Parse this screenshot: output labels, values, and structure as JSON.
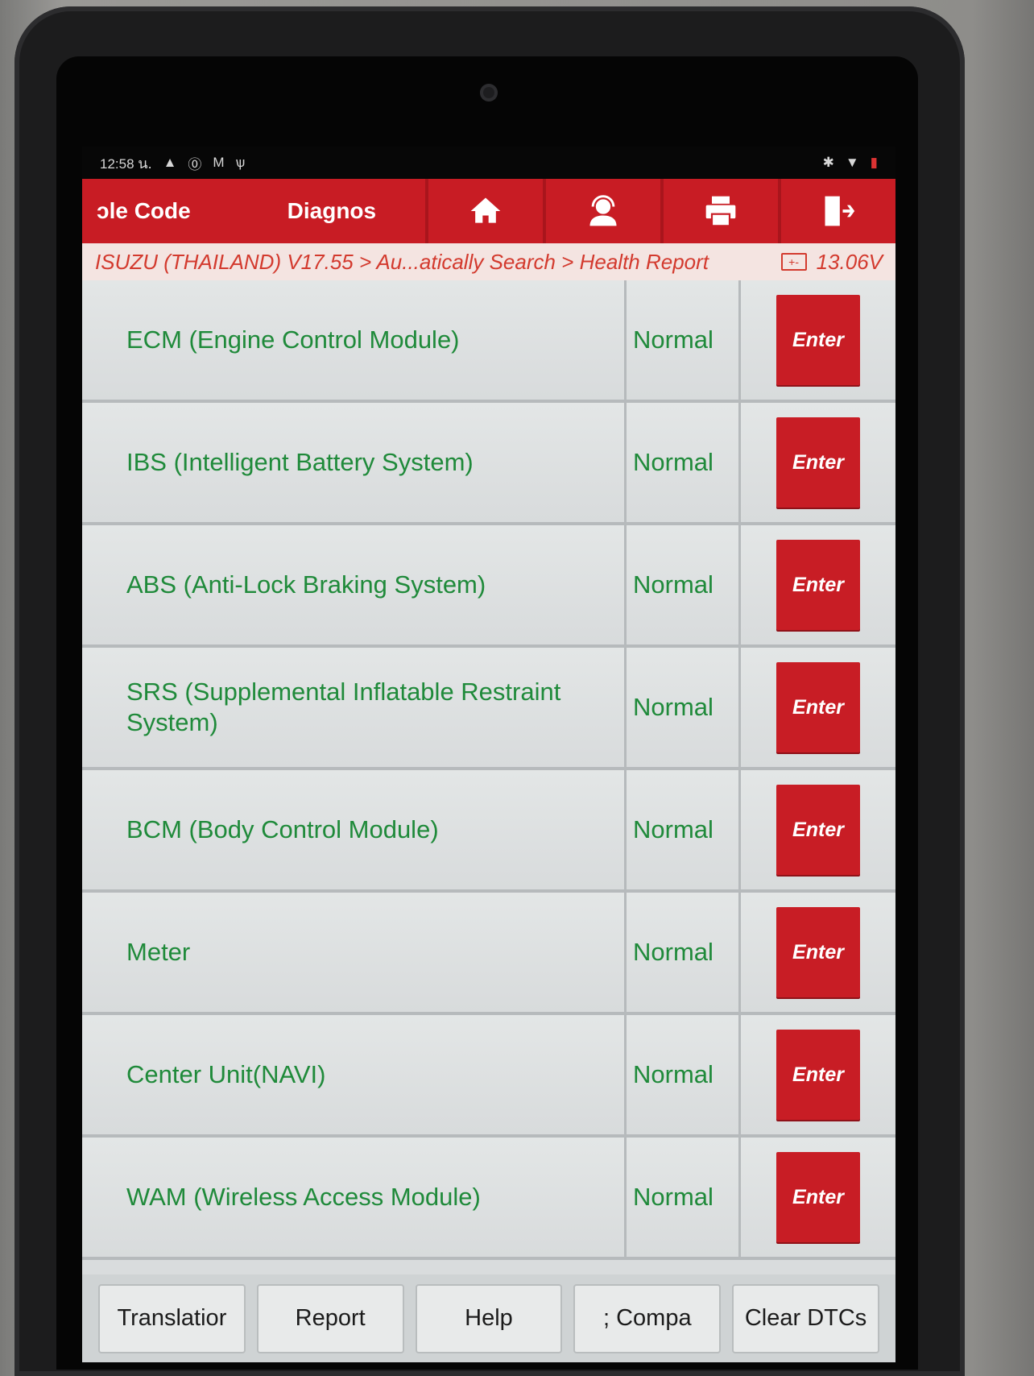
{
  "status_bar": {
    "time": "12:58",
    "time_suffix": "น.",
    "left_icons": [
      "warning-icon",
      "accessibility-icon",
      "gmail-icon",
      "usb-icon"
    ],
    "right_icons": [
      "bluetooth-icon",
      "wifi-icon",
      "battery-icon"
    ]
  },
  "toolbar": {
    "tab_1": "ɔle Code",
    "tab_2": "Diagnos",
    "buttons": [
      "home-icon",
      "support-icon",
      "print-icon",
      "exit-icon"
    ]
  },
  "breadcrumb": {
    "path": "ISUZU (THAILAND) V17.55 > Au...atically Search > Health Report",
    "voltage": "13.06V"
  },
  "modules": [
    {
      "name": "ECM (Engine Control Module)",
      "status": "Normal",
      "action": "Enter"
    },
    {
      "name": "IBS (Intelligent Battery System)",
      "status": "Normal",
      "action": "Enter"
    },
    {
      "name": "ABS (Anti-Lock Braking System)",
      "status": "Normal",
      "action": "Enter"
    },
    {
      "name": "SRS (Supplemental Inflatable Restraint System)",
      "status": "Normal",
      "action": "Enter"
    },
    {
      "name": "BCM (Body Control Module)",
      "status": "Normal",
      "action": "Enter"
    },
    {
      "name": "Meter",
      "status": "Normal",
      "action": "Enter"
    },
    {
      "name": "Center Unit(NAVI)",
      "status": "Normal",
      "action": "Enter"
    },
    {
      "name": "WAM (Wireless Access Module)",
      "status": "Normal",
      "action": "Enter"
    }
  ],
  "bottom_buttons": [
    "Translatior",
    "Report",
    "Help",
    "; Compa",
    "Clear DTCs"
  ],
  "colors": {
    "brand_red": "#c81c24",
    "status_green": "#1f8a3a"
  }
}
